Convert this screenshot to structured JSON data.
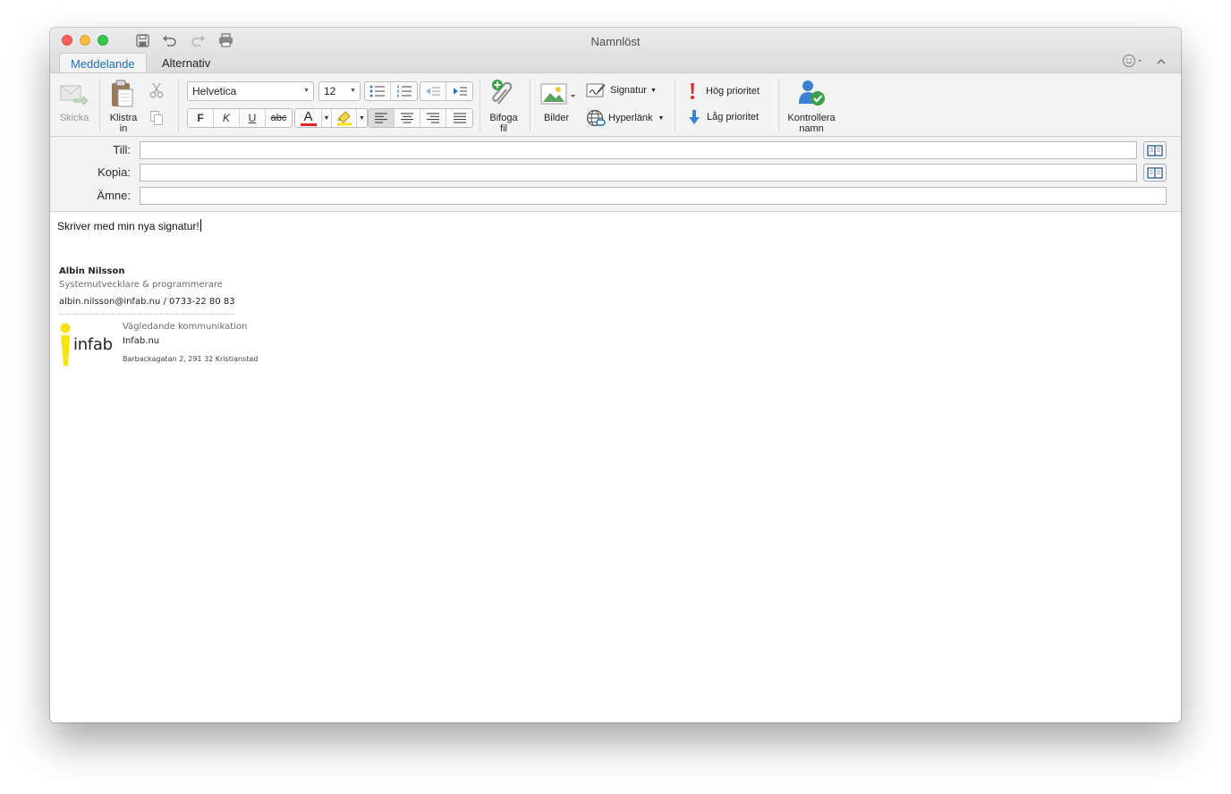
{
  "window": {
    "title": "Namnlöst"
  },
  "tabs": [
    {
      "label": "Meddelande"
    },
    {
      "label": "Alternativ"
    }
  ],
  "ribbon": {
    "send": "Skicka",
    "paste_line1": "Klistra",
    "paste_line2": "in",
    "font_name": "Helvetica",
    "font_size": "12",
    "bold": "F",
    "italic": "K",
    "underline": "U",
    "strike": "abc",
    "font_color_letter": "A",
    "attach_line1": "Bifoga",
    "attach_line2": "fil",
    "pictures": "Bilder",
    "signature": "Signatur",
    "hyperlink": "Hyperlänk",
    "high_priority": "Hög prioritet",
    "low_priority": "Låg prioritet",
    "check_names_line1": "Kontrollera",
    "check_names_line2": "namn"
  },
  "headers": {
    "to_label": "Till:",
    "cc_label": "Kopia:",
    "subject_label": "Ämne:",
    "to_value": "",
    "cc_value": "",
    "subject_value": ""
  },
  "message": {
    "text": "Skriver med min nya signatur!",
    "signature": {
      "name": "Albin Nilsson",
      "role": "Systemutvecklare & programmerare",
      "contact": "albin.nilsson@infab.nu / 0733-22 80 83",
      "tagline": "Vägledande kommunikation",
      "website": "Infab.nu",
      "address": "Barbackagatan 2, 291 32 Kristianstad",
      "logo_text": "infab"
    }
  },
  "colors": {
    "accent": "#1c6fb8",
    "logo_yellow": "#f7e313",
    "font_color": "#e0242a",
    "highlight": "#f7e313"
  }
}
